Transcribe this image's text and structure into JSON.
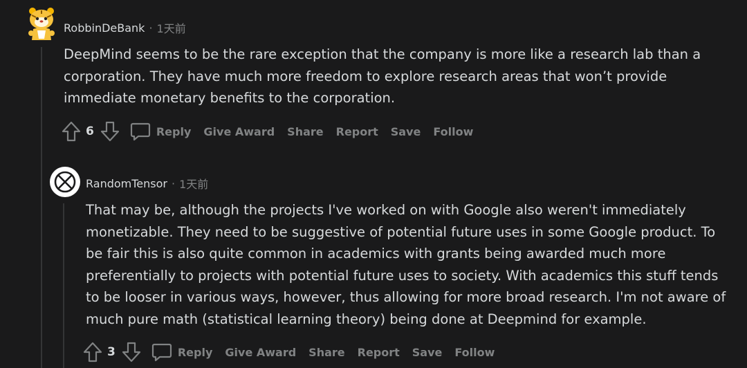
{
  "comments": [
    {
      "username": "RobbinDeBank",
      "separator": "·",
      "time": "1天前",
      "body": [
        "DeepMind seems to be the rare exception that the company is more like a research lab than a corporation. They have much more freedom to explore research areas that won’t provide immediate monetary benefits to the corporation."
      ],
      "votes": "6",
      "actions": {
        "reply": "Reply",
        "award": "Give Award",
        "share": "Share",
        "report": "Report",
        "save": "Save",
        "follow": "Follow"
      }
    },
    {
      "username": "RandomTensor",
      "separator": "·",
      "time": "1天前",
      "body": [
        "That may be, although the projects I've worked on with Google also weren't immediately monetizable. They need to be suggestive of potential future uses in some Google product. To be fair this is also quite common in academics with grants being awarded much more preferentially to projects with potential future uses to society. With academics this stuff tends to be looser in various ways, however, thus allowing for more broad research. I'm not aware of much pure math (statistical learning theory) being done at Deepmind for example."
      ],
      "votes": "3",
      "actions": {
        "reply": "Reply",
        "award": "Give Award",
        "share": "Share",
        "report": "Report",
        "save": "Save",
        "follow": "Follow"
      }
    }
  ],
  "icons": {
    "avatar1": "snoo-avatar-icon",
    "avatar2": "x-circle-avatar-icon",
    "upvote": "upvote-arrow-icon",
    "downvote": "downvote-arrow-icon",
    "reply": "speech-bubble-icon"
  },
  "colors": {
    "background": "#1a1a1b",
    "text": "#d7dadc",
    "muted": "#818384",
    "thread_line": "#343536"
  }
}
